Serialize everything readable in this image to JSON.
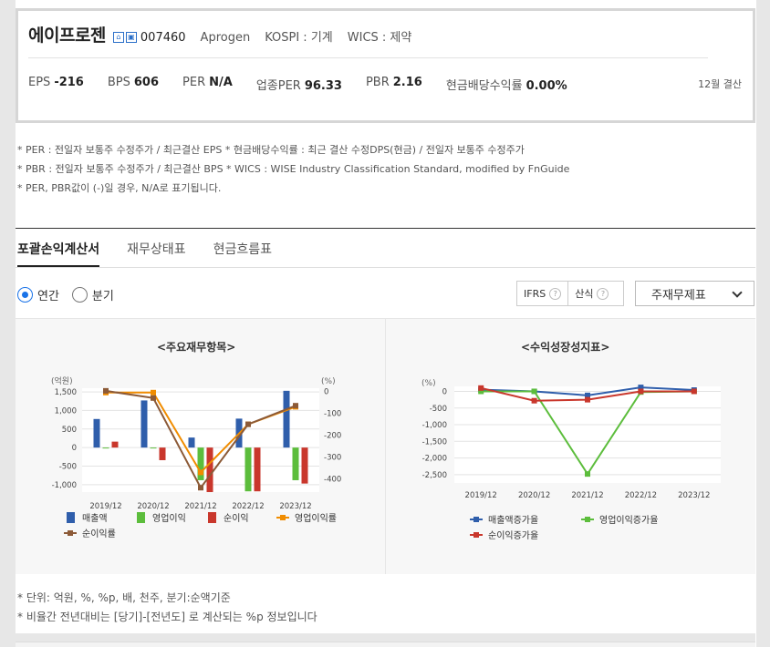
{
  "summary": {
    "corp_name": "에이프로젠",
    "code": "007460",
    "eng_name": "Aprogen",
    "market": "KOSPI : 기계",
    "wics": "WICS : 제약",
    "stats": [
      {
        "label": "EPS",
        "value": "-216"
      },
      {
        "label": "BPS",
        "value": "606"
      },
      {
        "label": "PER",
        "value": "N/A"
      },
      {
        "label": "업종PER",
        "value": "96.33"
      },
      {
        "label": "PBR",
        "value": "2.16"
      },
      {
        "label": "현금배당수익률",
        "value": "0.00%"
      }
    ],
    "fiscal": "12월 결산"
  },
  "notes": [
    "* PER : 전일자 보통주 수정주가 / 최근결산 EPS * 현금배당수익률 : 최근 결산 수정DPS(현금) / 전일자 보통주 수정주가",
    "* PBR : 전일자 보통주 수정주가 / 최근결산 BPS * WICS : WISE Industry Classification Standard, modified by FnGuide",
    "* PER, PBR값이 (-)일 경우, N/A로 표기됩니다."
  ],
  "tabs": [
    "포괄손익계산서",
    "재무상태표",
    "현금흐름표"
  ],
  "radios": {
    "annual": "연간",
    "quarter": "분기"
  },
  "controls": {
    "ifrs": "IFRS",
    "calc": "산식",
    "q": "?",
    "select": "주재무제표"
  },
  "chart_data": [
    {
      "type": "bar",
      "title": "<주요재무항목>",
      "left_unit": "(억원)",
      "right_unit": "(%)",
      "categories": [
        "2019/12",
        "2020/12",
        "2021/12",
        "2022/12",
        "2023/12"
      ],
      "ylim": [
        -1200,
        1600
      ],
      "yticks": [
        1500,
        1000,
        500,
        0,
        -500,
        -1000
      ],
      "ytick_labels": [
        "1,500",
        "1,000",
        "500",
        "0",
        "-500",
        "-1,000"
      ],
      "y2lim": [
        -460,
        15
      ],
      "y2ticks": [
        0,
        -100,
        -200,
        -300,
        -400
      ],
      "series": [
        {
          "name": "매출액",
          "kind": "bar",
          "color": "#2f5eab",
          "values": [
            770,
            1270,
            270,
            780,
            1530
          ]
        },
        {
          "name": "영업이익",
          "kind": "bar",
          "color": "#5cbd3c",
          "values": [
            -20,
            -10,
            -880,
            -1180,
            -880
          ]
        },
        {
          "name": "순이익",
          "kind": "bar",
          "color": "#c9372c",
          "values": [
            160,
            -340,
            -1200,
            -1180,
            -970
          ]
        },
        {
          "name": "영업이익률",
          "kind": "line",
          "axis": "right",
          "color": "#f08c00",
          "values": [
            -5,
            -5,
            -370,
            -150,
            -70
          ]
        },
        {
          "name": "순이익률",
          "kind": "line",
          "axis": "right",
          "color": "#8c5a37",
          "values": [
            3,
            -30,
            -440,
            -150,
            -65
          ]
        }
      ],
      "legend": "bottom"
    },
    {
      "type": "line",
      "title": "<수익성장성지표>",
      "unit": "(%)",
      "categories": [
        "2019/12",
        "2020/12",
        "2021/12",
        "2022/12",
        "2023/12"
      ],
      "ylim": [
        -2750,
        150
      ],
      "yticks": [
        0,
        -500,
        -1000,
        -1500,
        -2000,
        -2500
      ],
      "ytick_labels": [
        "0",
        "-500",
        "-1,000",
        "-1,500",
        "-2,000",
        "-2,500"
      ],
      "series": [
        {
          "name": "매출액증가율",
          "color": "#2f5eab",
          "values": [
            50,
            0,
            -120,
            120,
            40
          ]
        },
        {
          "name": "영업이익증가율",
          "color": "#5cbd3c",
          "values": [
            0,
            0,
            -2480,
            -20,
            0
          ]
        },
        {
          "name": "순이익증가율",
          "color": "#c9372c",
          "values": [
            100,
            -280,
            -250,
            0,
            0
          ]
        }
      ],
      "legend": "bottom"
    }
  ],
  "footnotes": [
    "* 단위: 억원, %, %p, 배, 천주, 분기:순액기준",
    "* 비율간 전년대비는 [당기]-[전년도] 로 계산되는 %p 정보입니다"
  ]
}
